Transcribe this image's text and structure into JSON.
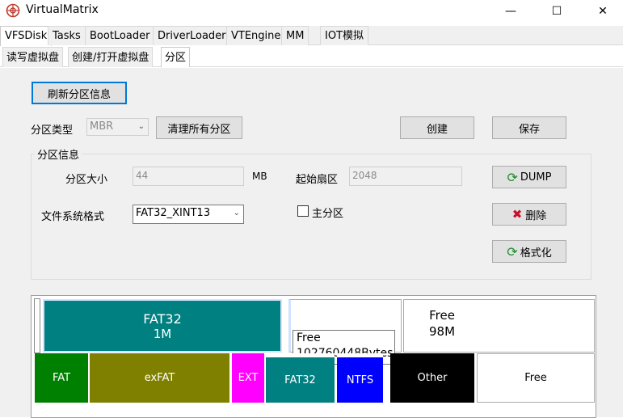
{
  "window": {
    "title": "VirtualMatrix",
    "minimize": "—",
    "maximize": "☐",
    "close": "✕"
  },
  "main_tabs": [
    "VFSDisk",
    "Tasks",
    "BootLoader",
    "DriverLoader",
    "VTEngine",
    "MM",
    "IOT模拟"
  ],
  "sub_tabs": [
    "读写虚拟盘",
    "创建/打开虚拟盘",
    "分区"
  ],
  "toolbar": {
    "refresh": "刷新分区信息",
    "partition_type_label": "分区类型",
    "partition_type_value": "MBR",
    "clear_all": "清理所有分区",
    "create": "创建",
    "save": "保存"
  },
  "partition_info": {
    "group_title": "分区信息",
    "size_label": "分区大小",
    "size_value": "44",
    "size_unit": "MB",
    "start_sector_label": "起始扇区",
    "start_sector_value": "2048",
    "fs_label": "文件系统格式",
    "fs_value": "FAT32_XINT13",
    "primary_label": "主分区",
    "primary_checked": false,
    "dump": "DUMP",
    "delete": "删除",
    "format": "格式化"
  },
  "partitions": [
    {
      "name": "FAT32",
      "size": "1M",
      "color": "#008080",
      "text_color": "#ffffff"
    },
    {
      "name": "",
      "size": "",
      "color": "#ffffff",
      "text_color": "#000000"
    },
    {
      "name": "Free",
      "size": "98M",
      "color": "#ffffff",
      "text_color": "#000000"
    }
  ],
  "tooltip": {
    "line1": "Free",
    "line2": "102760448Bytes"
  },
  "legend": [
    {
      "label": "FAT",
      "color": "#008000",
      "text_color": "#ffffff"
    },
    {
      "label": "exFAT",
      "color": "#808000",
      "text_color": "#ffffff"
    },
    {
      "label": "EXT",
      "color": "#ff00ff",
      "text_color": "#ffffff"
    },
    {
      "label": "FAT32",
      "color": "#008080",
      "text_color": "#ffffff"
    },
    {
      "label": "NTFS",
      "color": "#0000ff",
      "text_color": "#ffffff"
    },
    {
      "label": "Other",
      "color": "#000000",
      "text_color": "#ffffff"
    },
    {
      "label": "Free",
      "color": "#ffffff",
      "text_color": "#000000"
    }
  ],
  "colors": {
    "accent": "#0078d7",
    "refresh_icon": "#1e8a2e",
    "delete_icon": "#c8102e"
  }
}
